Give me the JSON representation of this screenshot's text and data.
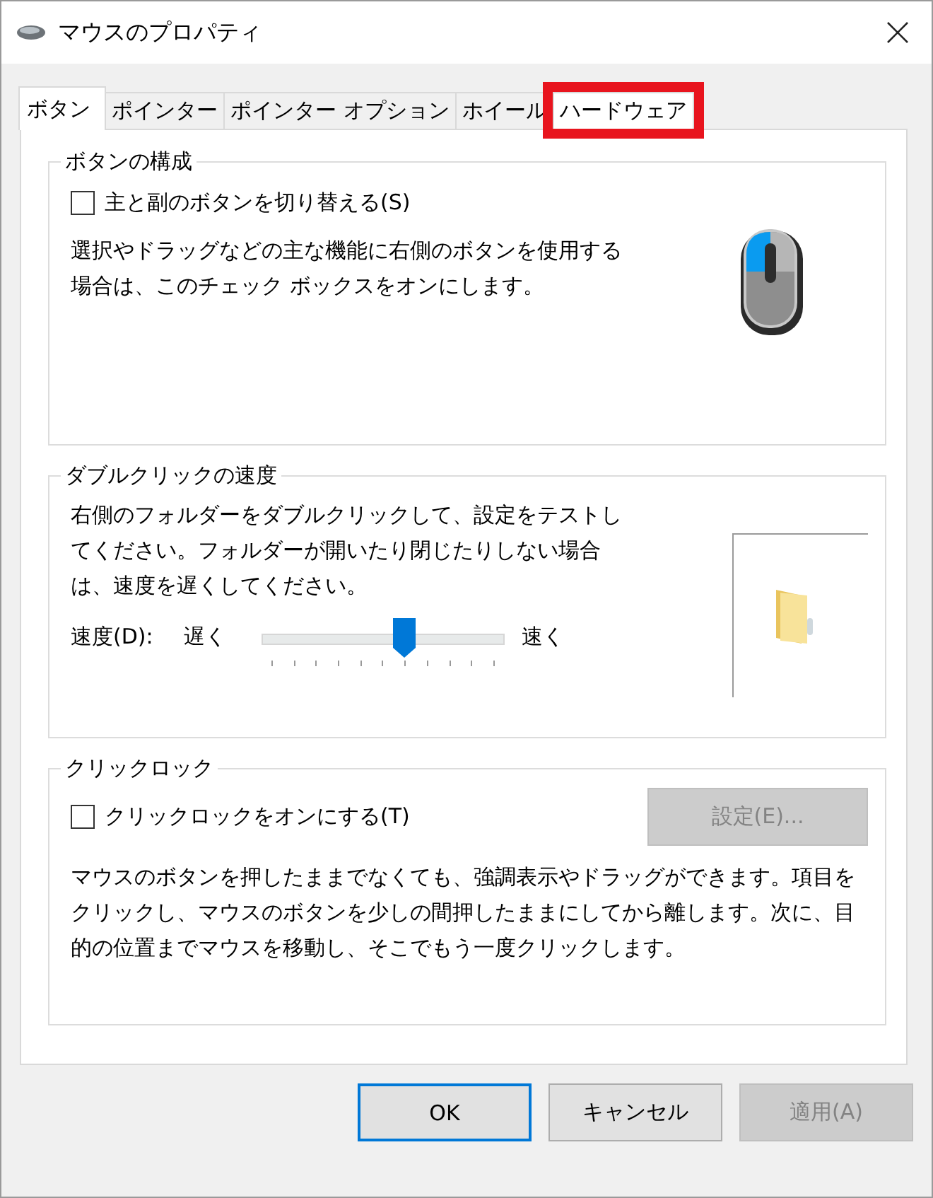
{
  "window": {
    "title": "マウスのプロパティ"
  },
  "tabs": [
    {
      "label": "ボタン",
      "selected": true,
      "highlighted": false
    },
    {
      "label": "ポインター",
      "selected": false,
      "highlighted": false
    },
    {
      "label": "ポインター オプション",
      "selected": false,
      "highlighted": false
    },
    {
      "label": "ホイール",
      "selected": false,
      "highlighted": false
    },
    {
      "label": "ハードウェア",
      "selected": false,
      "highlighted": true
    }
  ],
  "button_config": {
    "title": "ボタンの構成",
    "checkbox": {
      "label": "主と副のボタンを切り替える(S)",
      "checked": false
    },
    "description": "選択やドラッグなどの主な機能に右側のボタンを使用する場合は、このチェック ボックスをオンにします。"
  },
  "double_click": {
    "title": "ダブルクリックの速度",
    "description": "右側のフォルダーをダブルクリックして、設定をテストしてください。フォルダーが開いたり閉じたりしない場合は、速度を遅くしてください。",
    "speed_label": "速度(D):",
    "slow_label": "遅く",
    "fast_label": "速く",
    "slider": {
      "level": 0.59
    }
  },
  "click_lock": {
    "title": "クリックロック",
    "checkbox": {
      "label": "クリックロックをオンにする(T)",
      "checked": false
    },
    "settings_button": {
      "label": "設定(E)...",
      "disabled": true
    },
    "description": "マウスのボタンを押したままでなくても、強調表示やドラッグができます。項目をクリックし、マウスのボタンを少しの間押したままにしてから離します。次に、目的の位置までマウスを移動し、そこでもう一度クリックします。"
  },
  "buttons": [
    {
      "label": "OK",
      "kind": "default",
      "disabled": false
    },
    {
      "label": "キャンセル",
      "kind": "normal",
      "disabled": false
    },
    {
      "label": "適用(A)",
      "kind": "normal",
      "disabled": true
    }
  ]
}
